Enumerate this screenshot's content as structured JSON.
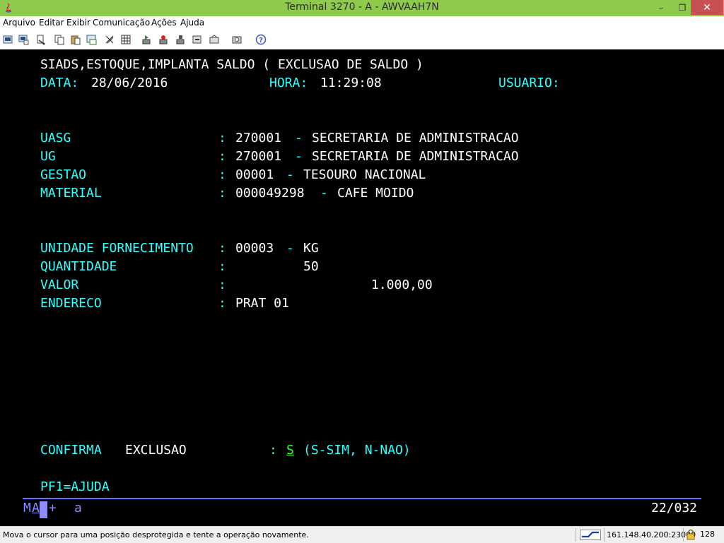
{
  "window": {
    "title": "Terminal 3270 - A - AWVAAH7N",
    "minimize_label": "–",
    "maximize_label": "❐",
    "close_label": "✕"
  },
  "menu": {
    "items": [
      "Arquivo",
      "Editar",
      "Exibir",
      "Comunicação",
      "Ações",
      "Ajuda"
    ]
  },
  "toolbar": {
    "icons": [
      "copy-screen-icon",
      "print-screen-icon",
      "cut-icon",
      "copy-icon",
      "paste-icon",
      "transfer-icon",
      "keypad-icon",
      "macro-play-icon",
      "macro-record-icon",
      "macro-stop-icon",
      "send-icon",
      "receive-icon",
      "configure-icon",
      "help-icon"
    ]
  },
  "screen": {
    "header": {
      "title": "SIADS,ESTOQUE,IMPLANTA SALDO ( EXCLUSAO DE SALDO )",
      "data_label": "DATA:",
      "data_value": "28/06/2016",
      "hora_label": "HORA:",
      "hora_value": "11:29:08",
      "usuario_label": "USUARIO:"
    },
    "fields": {
      "uasg_label": "UASG",
      "uasg_colon": ":",
      "uasg_code": "270001",
      "uasg_dash": "-",
      "uasg_desc": "SECRETARIA DE ADMINISTRACAO",
      "ug_label": "UG",
      "ug_colon": ":",
      "ug_code": "270001",
      "ug_dash": "-",
      "ug_desc": "SECRETARIA DE ADMINISTRACAO",
      "gestao_label": "GESTAO",
      "gestao_colon": ":",
      "gestao_code": "00001",
      "gestao_dash": "-",
      "gestao_desc": "TESOURO NACIONAL",
      "material_label": "MATERIAL",
      "material_colon": ":",
      "material_code": "000049298",
      "material_dash": "-",
      "material_desc": "CAFE MOIDO",
      "unidade_label": "UNIDADE FORNECIMENTO",
      "unidade_colon": ":",
      "unidade_code": "00003",
      "unidade_dash": "-",
      "unidade_desc": "KG",
      "quantidade_label": "QUANTIDADE",
      "quantidade_colon": ":",
      "quantidade_value": "50",
      "valor_label": "VALOR",
      "valor_colon": ":",
      "valor_value": "1.000,00",
      "endereco_label": "ENDERECO",
      "endereco_colon": ":",
      "endereco_value": "PRAT 01"
    },
    "confirm": {
      "label": "CONFIRMA",
      "action": "EXCLUSAO",
      "colon": ":",
      "input_value": "S",
      "options": "(S-SIM, N-NAO)"
    },
    "pf1": "PF1=AJUDA"
  },
  "oia": {
    "left_m": "M",
    "left_a": "A",
    "plus": "+",
    "a": "a",
    "cursor_pos": "22/032"
  },
  "statusbar": {
    "message": "Mova o cursor para uma posição desprotegida e tente a operação novamente.",
    "host": "161.148.40.200:23000",
    "encryption": "128"
  },
  "colors": {
    "titlebar": "#8ecb4c",
    "terminal_bg": "#000000",
    "protected_field": "#33ffff",
    "unprotected_field": "#ffffff",
    "input_field": "#33ff33",
    "oia": "#8c8cff"
  }
}
